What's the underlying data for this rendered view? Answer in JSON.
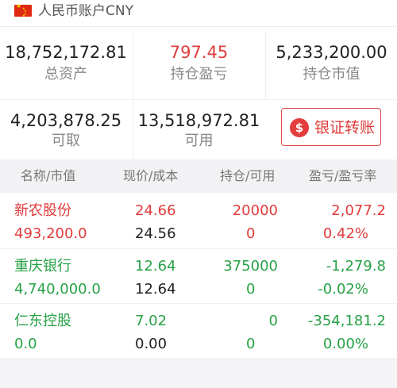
{
  "account": {
    "title": "人民币账户CNY"
  },
  "summary": {
    "total_assets": {
      "value": "18,752,172.81",
      "label": "总资产"
    },
    "position_pl": {
      "value": "797.45",
      "label": "持仓盈亏"
    },
    "position_value": {
      "value": "5,233,200.00",
      "label": "持仓市值"
    },
    "withdrawable": {
      "value": "4,203,878.25",
      "label": "可取"
    },
    "available": {
      "value": "13,518,972.81",
      "label": "可用"
    }
  },
  "transfer_button": {
    "label": "银证转账"
  },
  "table": {
    "headers": [
      "名称/市值",
      "现价/成本",
      "持仓/可用",
      "盈亏/盈亏率"
    ],
    "rows": [
      {
        "name": "新农股份",
        "market_value": "493,200.0",
        "price": "24.66",
        "cost": "24.56",
        "qty": "20000",
        "available": "0",
        "pl": "2,077.2",
        "pl_rate": "0.42%",
        "status": "up"
      },
      {
        "name": "重庆银行",
        "market_value": "4,740,000.0",
        "price": "12.64",
        "cost": "12.64",
        "qty": "375000",
        "available": "0",
        "pl": "-1,279.8",
        "pl_rate": "-0.02%",
        "status": "down"
      },
      {
        "name": "仁东控股",
        "market_value": "0.0",
        "price": "7.02",
        "cost": "0.00",
        "qty": "0",
        "available": "0",
        "pl": "-354,181.2",
        "pl_rate": "0.00%",
        "status": "down"
      }
    ]
  },
  "colors": {
    "up": "#e03c3c",
    "down": "#26a146",
    "header_bg": "#f2f2f4"
  }
}
